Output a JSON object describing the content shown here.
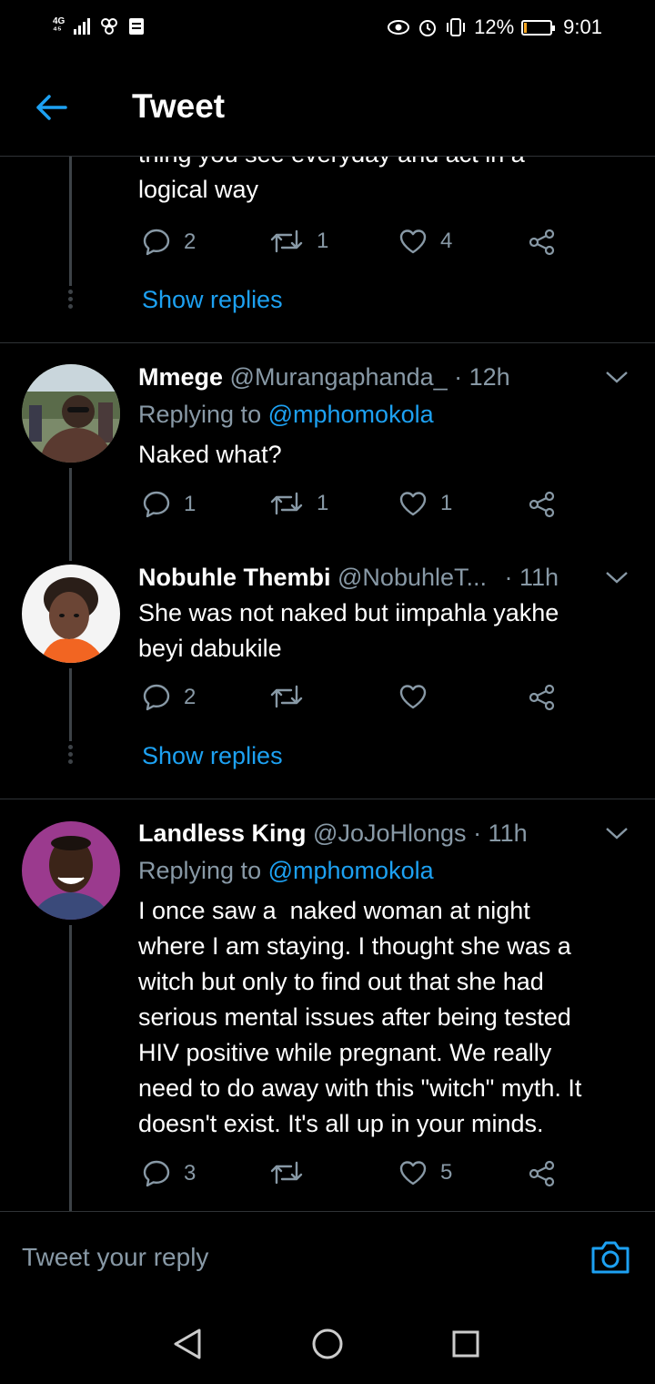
{
  "status_bar": {
    "network": "4G",
    "battery_text": "12%",
    "battery_level": 0.12,
    "time": "9:01"
  },
  "header": {
    "title": "Tweet"
  },
  "tweets": [
    {
      "text": "thing you see everyday and act in a\nlogical way",
      "replies": "2",
      "retweets": "1",
      "likes": "4",
      "show_replies": "Show replies"
    },
    {
      "name": "Mmege",
      "handle": "@Murangaphanda_",
      "time": "· 12h",
      "replying_label": "Replying to",
      "replying_to": "@mphomokola",
      "text": "Naked what?",
      "replies": "1",
      "retweets": "1",
      "likes": "1"
    },
    {
      "name": "Nobuhle Thembi",
      "handle": "@NobuhleT...",
      "time": "· 11h",
      "text": "She was not naked but iimpahla yakhe\nbeyi dabukile",
      "replies": "2",
      "retweets": "",
      "likes": "",
      "show_replies": "Show replies"
    },
    {
      "name": "Landless King",
      "handle": "@JoJoHlongs",
      "time": "· 11h",
      "replying_label": "Replying to",
      "replying_to": "@mphomokola",
      "text": "I once saw a  naked woman at night\nwhere I am staying. I thought she was a\nwitch but only to find out that she had\nserious mental issues after being tested\nHIV positive while pregnant. We really\nneed to do away with this \"witch\" myth. It\ndoesn't exist. It's all up in your minds.",
      "replies": "3",
      "retweets": "",
      "likes": "5"
    }
  ],
  "compose": {
    "placeholder": "Tweet your reply"
  },
  "colors": {
    "accent": "#1da1f2",
    "secondary_text": "#8899a6",
    "background": "#000000"
  }
}
